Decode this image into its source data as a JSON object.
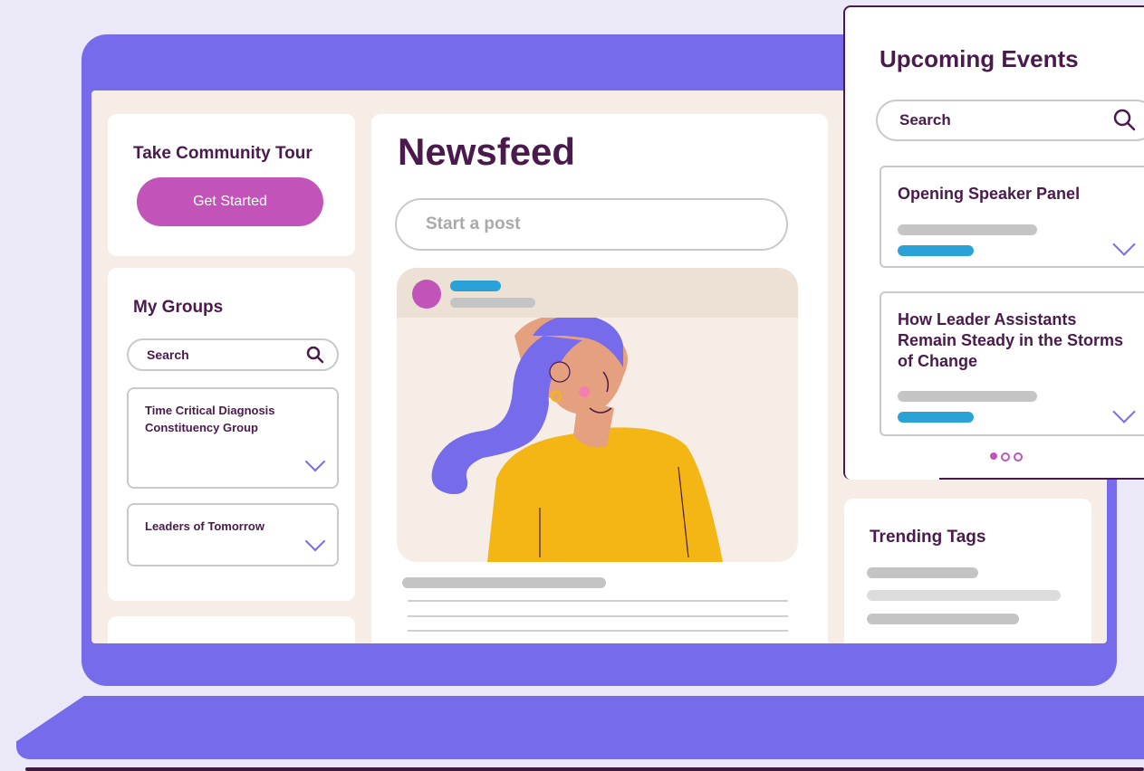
{
  "tour": {
    "title": "Take Community Tour",
    "button_label": "Get Started"
  },
  "groups": {
    "title": "My Groups",
    "search_placeholder": "Search",
    "items": [
      {
        "label": "Time Critical Diagnosis Constituency Group"
      },
      {
        "label": "Leaders of Tomorrow"
      }
    ]
  },
  "newsfeed": {
    "title": "Newsfeed",
    "post_placeholder": "Start a post"
  },
  "events": {
    "title": "Upcoming Events",
    "search_placeholder": "Search",
    "items": [
      {
        "title": "Opening Speaker Panel"
      },
      {
        "title": "How Leader Assistants Remain Steady in the Storms of Change"
      }
    ]
  },
  "trending": {
    "title": "Trending Tags"
  },
  "colors": {
    "accent_purple": "#766ceb",
    "button_magenta": "#c254b9",
    "text_dark": "#4a1a4c",
    "link_blue": "#2aa2d8"
  },
  "icons": [
    "search-icon",
    "chevron-down-icon",
    "pagination-dots"
  ]
}
